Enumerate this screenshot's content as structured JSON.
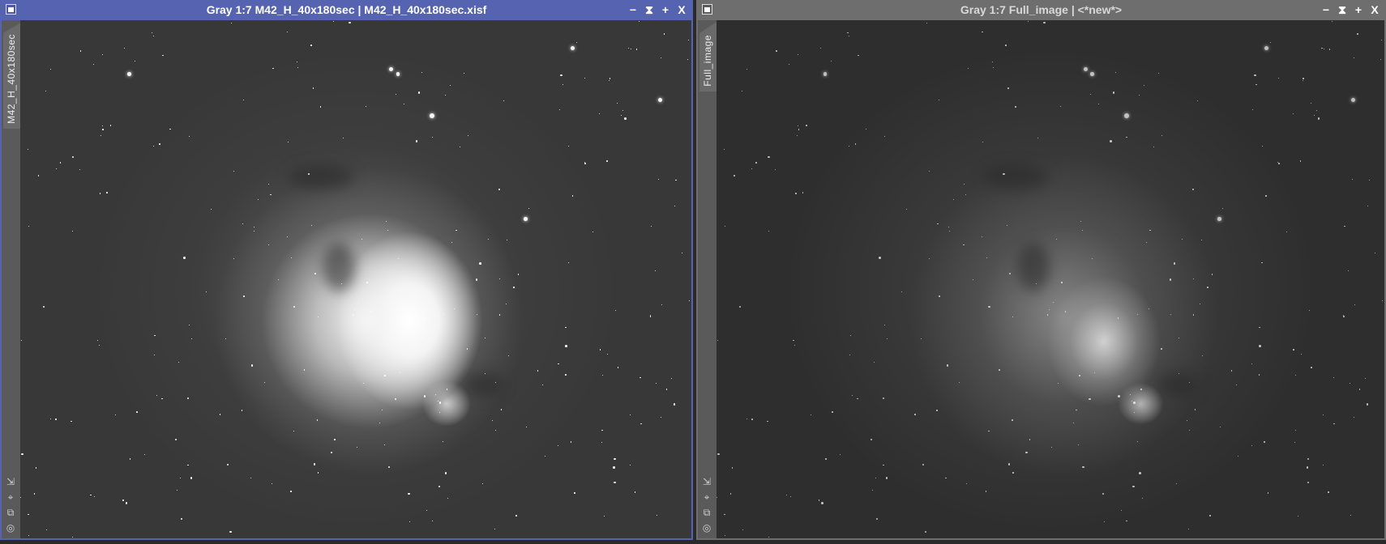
{
  "windows": [
    {
      "title": "Gray 1:7 M42_H_40x180sec | M42_H_40x180sec.xisf",
      "tab_label": "M42_H_40x180sec",
      "active": true
    },
    {
      "title": "Gray 1:7 Full_image | <*new*>",
      "tab_label": "Full_image",
      "active": false
    }
  ],
  "controls": {
    "minimize": "−",
    "shade": "⧗",
    "maximize": "+",
    "close": "X"
  },
  "side_tools": [
    "⇲",
    "⌖",
    "⧉",
    "◎"
  ],
  "colors": {
    "active_title": "#5563b0",
    "inactive_title": "#6e6e6e",
    "tab_marker": "#2fc060"
  }
}
